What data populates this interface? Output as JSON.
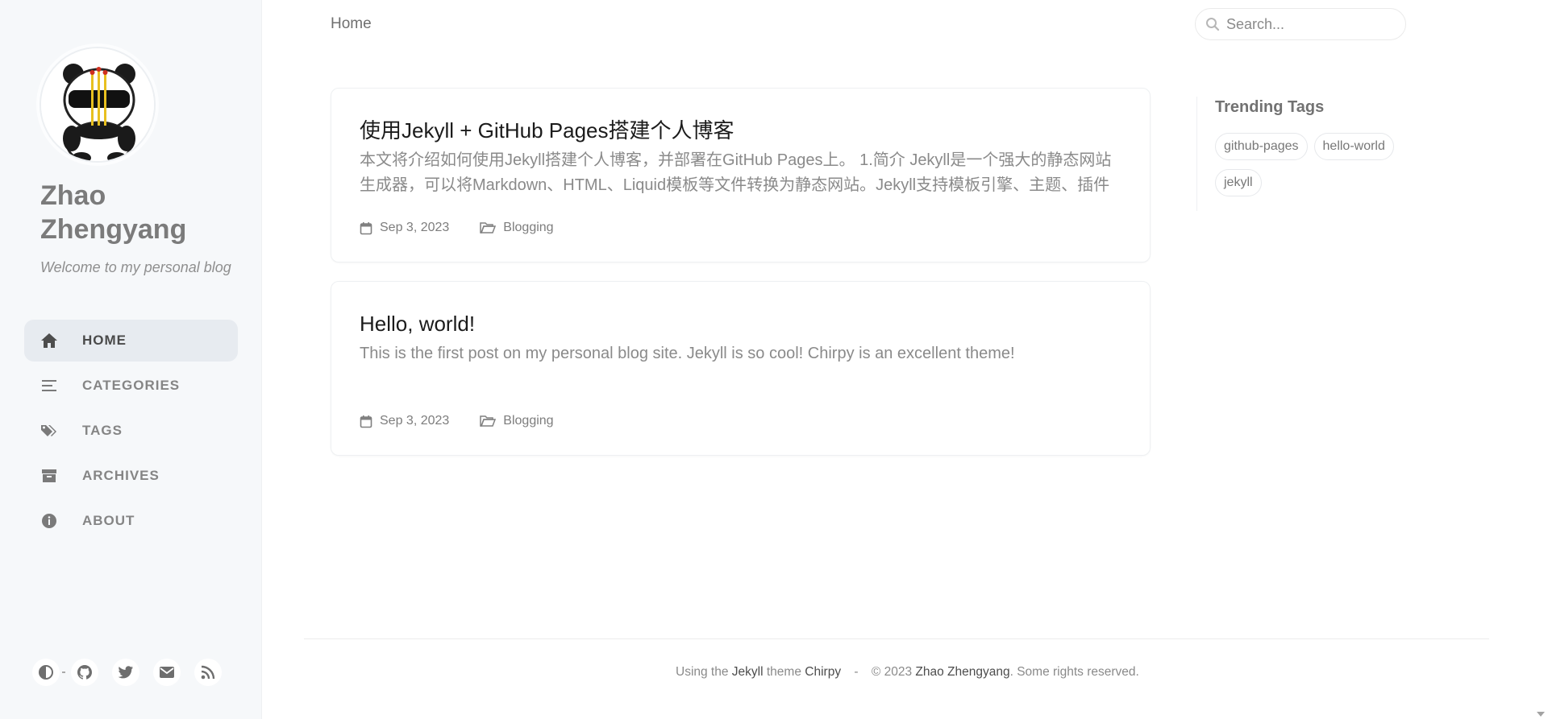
{
  "sidebar": {
    "avatar_icon": "panda-avatar",
    "title": "Zhao Zhengyang",
    "subtitle": "Welcome to my personal blog",
    "nav": [
      {
        "label": "HOME",
        "icon": "home-icon",
        "active": true
      },
      {
        "label": "CATEGORIES",
        "icon": "stream-icon",
        "active": false
      },
      {
        "label": "TAGS",
        "icon": "tags-icon",
        "active": false
      },
      {
        "label": "ARCHIVES",
        "icon": "archive-icon",
        "active": false
      },
      {
        "label": "ABOUT",
        "icon": "info-icon",
        "active": false
      }
    ],
    "bottom_icons": [
      "theme-toggle-icon",
      "github-icon",
      "twitter-icon",
      "email-icon",
      "rss-icon"
    ]
  },
  "topbar": {
    "breadcrumb": "Home",
    "search_placeholder": "Search..."
  },
  "posts": [
    {
      "title": "使用Jekyll + GitHub Pages搭建个人博客",
      "excerpt": "本文将介绍如何使用Jekyll搭建个人博客，并部署在GitHub Pages上。 1.简介 Jekyll是一个强大的静态网站生成器，可以将Markdown、HTML、Liquid模板等文件转换为静态网站。Jekyll支持模板引擎、主题、插件等功能",
      "date": "Sep 3, 2023",
      "category": "Blogging"
    },
    {
      "title": "Hello, world!",
      "excerpt": "This is the first post on my personal blog site. Jekyll is so cool! Chirpy is an excellent theme!",
      "date": "Sep 3, 2023",
      "category": "Blogging"
    }
  ],
  "trending": {
    "title": "Trending Tags",
    "tags": [
      "github-pages",
      "hello-world",
      "jekyll"
    ]
  },
  "footer": {
    "using_the": "Using the",
    "jekyll": "Jekyll",
    "theme": "theme",
    "chirpy": "Chirpy",
    "dash": "-",
    "copyright": "© 2023",
    "author": "Zhao Zhengyang",
    "rights": ". Some rights reserved."
  },
  "colors": {
    "sidebar_bg": "#f6f8fa",
    "nav_active_bg": "#e7ebf0"
  }
}
